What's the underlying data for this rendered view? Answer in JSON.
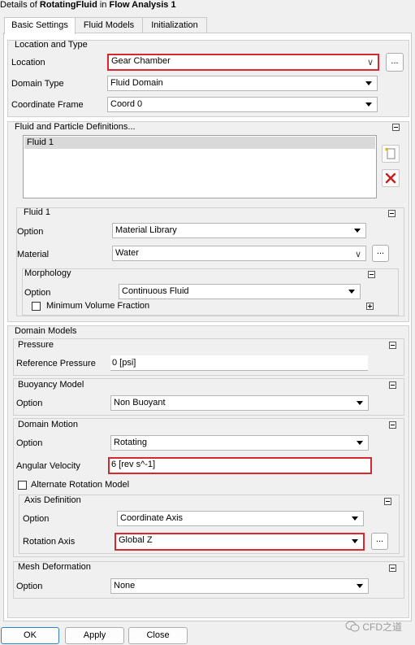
{
  "header": {
    "prefix": "Details of",
    "object": "RotatingFluid",
    "mid": "in",
    "analysis": "Flow Analysis 1"
  },
  "tabs": [
    "Basic Settings",
    "Fluid Models",
    "Initialization"
  ],
  "location_type": {
    "title": "Location and Type",
    "location_label": "Location",
    "location_value": "Gear Chamber",
    "domain_type_label": "Domain Type",
    "domain_type_value": "Fluid Domain",
    "coord_label": "Coordinate Frame",
    "coord_value": "Coord 0",
    "ellipsis": "..."
  },
  "fluid_defs": {
    "title": "Fluid and Particle Definitions...",
    "items": [
      "Fluid 1"
    ]
  },
  "fluid1": {
    "title": "Fluid 1",
    "option_label": "Option",
    "option_value": "Material Library",
    "material_label": "Material",
    "material_value": "Water",
    "morphology": {
      "title": "Morphology",
      "option_label": "Option",
      "option_value": "Continuous Fluid",
      "min_vol_label": "Minimum Volume Fraction"
    }
  },
  "domain_models": {
    "title": "Domain Models",
    "pressure": {
      "title": "Pressure",
      "ref_label": "Reference Pressure",
      "ref_value": "0 [psi]"
    },
    "buoyancy": {
      "title": "Buoyancy Model",
      "option_label": "Option",
      "option_value": "Non Buoyant"
    },
    "motion": {
      "title": "Domain Motion",
      "option_label": "Option",
      "option_value": "Rotating",
      "angular_label": "Angular Velocity",
      "angular_value": "6 [rev s^-1]",
      "alt_rot_label": "Alternate Rotation Model",
      "axis_def": {
        "title": "Axis Definition",
        "option_label": "Option",
        "option_value": "Coordinate Axis",
        "rot_axis_label": "Rotation Axis",
        "rot_axis_value": "Global Z"
      }
    },
    "mesh": {
      "title": "Mesh Deformation",
      "option_label": "Option",
      "option_value": "None"
    }
  },
  "buttons": {
    "ok": "OK",
    "apply": "Apply",
    "close": "Close"
  },
  "watermark": "CFD之道",
  "colors": {
    "highlight_red": "#d8282e",
    "ok_border": "#2f7fc4"
  }
}
